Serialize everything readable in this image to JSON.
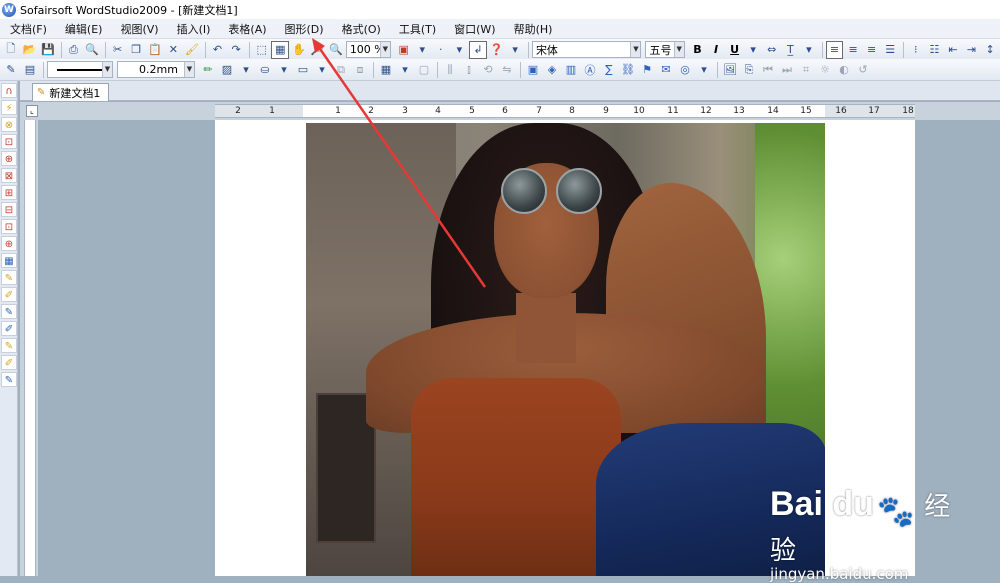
{
  "window": {
    "title": "Sofairsoft WordStudio2009 - [新建文档1]"
  },
  "menu": {
    "items": [
      "文档(F)",
      "编辑(E)",
      "视图(V)",
      "插入(I)",
      "表格(A)",
      "图形(D)",
      "格式(O)",
      "工具(T)",
      "窗口(W)",
      "帮助(H)"
    ]
  },
  "toolbar": {
    "zoom": "100 %",
    "font_name": "宋体",
    "font_size": "五号",
    "bold_label": "B",
    "italic_label": "I",
    "underline_label": "U",
    "line_width": "0.2mm"
  },
  "document": {
    "tab_label": "新建文档1"
  },
  "ruler": {
    "labels": [
      "2",
      "1",
      "1",
      "2",
      "3",
      "4",
      "5",
      "6",
      "7",
      "8",
      "9",
      "10",
      "11",
      "12",
      "13",
      "14",
      "15",
      "16",
      "17",
      "18"
    ]
  },
  "watermark": {
    "logo": "Bai du",
    "cn": "经验",
    "url": "jingyan.baidu.com"
  },
  "annotation": {
    "arrow_color": "#e53935"
  }
}
